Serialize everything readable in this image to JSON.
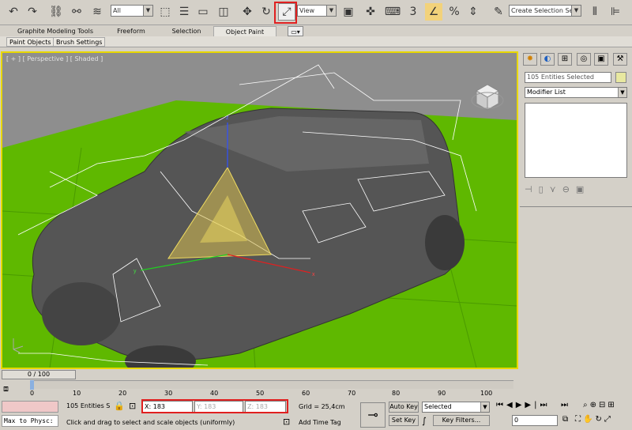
{
  "toolbar": {
    "selection_filter": "All",
    "ref_coord": "View",
    "named_selection_placeholder": "Create Selection Se",
    "snap_label": "3",
    "pct_label": "%"
  },
  "ribbon": {
    "tabs": [
      "Graphite Modeling Tools",
      "Freeform",
      "Selection",
      "Object Paint"
    ],
    "sub_tabs": [
      "Paint Objects",
      "Brush Settings"
    ]
  },
  "viewport": {
    "label": "[ + ] [ Perspective ] [ Shaded ]"
  },
  "command_panel": {
    "selection_name": "105 Entities Selected",
    "modifier_list": "Modifier List"
  },
  "timeline": {
    "frame_label": "0 / 100",
    "ticks": [
      "0",
      "10",
      "20",
      "30",
      "40",
      "50",
      "60",
      "70",
      "80",
      "90",
      "100"
    ]
  },
  "status": {
    "selection_info": "105 Entities S",
    "x_label": "X:",
    "x_value": "183",
    "y_label": "Y:",
    "y_value": "183",
    "z_label": "Z:",
    "z_value": "183",
    "grid": "Grid = 25,4cm",
    "prompt": "Click and drag to select and scale objects (uniformly)",
    "add_time_tag": "Add Time Tag",
    "auto_key": "Auto Key",
    "set_key": "Set Key",
    "key_mode": "Selected",
    "key_filters": "Key Filters...",
    "max_script": "Max to Physc:",
    "current_frame": "0"
  }
}
